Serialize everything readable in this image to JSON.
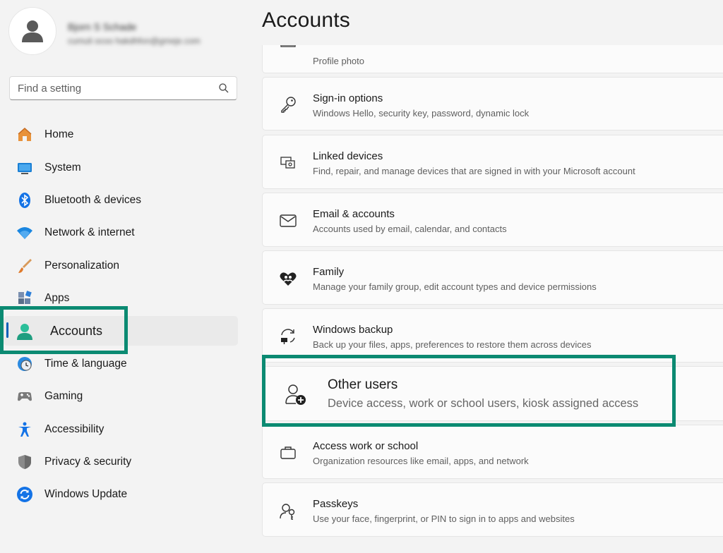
{
  "profile": {
    "name": "Bjorn S Schade",
    "email": "cumuli ocoo hakdhfon@gmeje.com"
  },
  "search": {
    "placeholder": "Find a setting"
  },
  "nav": {
    "items": [
      {
        "label": "Home",
        "icon": "home-icon"
      },
      {
        "label": "System",
        "icon": "system-icon"
      },
      {
        "label": "Bluetooth & devices",
        "icon": "bluetooth-icon"
      },
      {
        "label": "Network & internet",
        "icon": "wifi-icon"
      },
      {
        "label": "Personalization",
        "icon": "brush-icon"
      },
      {
        "label": "Apps",
        "icon": "apps-icon"
      },
      {
        "label": "Accounts",
        "icon": "account-icon"
      },
      {
        "label": "Time & language",
        "icon": "clock-globe-icon"
      },
      {
        "label": "Gaming",
        "icon": "gamepad-icon"
      },
      {
        "label": "Accessibility",
        "icon": "accessibility-icon"
      },
      {
        "label": "Privacy & security",
        "icon": "shield-icon"
      },
      {
        "label": "Windows Update",
        "icon": "update-icon"
      }
    ]
  },
  "main": {
    "title": "Accounts",
    "cards": [
      {
        "title": "",
        "subtitle": "Profile photo",
        "icon": "profile-photo-icon"
      },
      {
        "title": "Sign-in options",
        "subtitle": "Windows Hello, security key, password, dynamic lock",
        "icon": "key-icon"
      },
      {
        "title": "Linked devices",
        "subtitle": "Find, repair, and manage devices that are signed in with your Microsoft account",
        "icon": "linked-devices-icon"
      },
      {
        "title": "Email & accounts",
        "subtitle": "Accounts used by email, calendar, and contacts",
        "icon": "mail-icon"
      },
      {
        "title": "Family",
        "subtitle": "Manage your family group, edit account types and device permissions",
        "icon": "family-heart-icon"
      },
      {
        "title": "Windows backup",
        "subtitle": "Back up your files, apps, preferences to restore them across devices",
        "icon": "backup-icon"
      },
      {
        "title": "Other users",
        "subtitle": "Device access, work or school users, kiosk assigned access",
        "icon": "add-user-icon"
      },
      {
        "title": "Access work or school",
        "subtitle": "Organization resources like email, apps, and network",
        "icon": "briefcase-icon"
      },
      {
        "title": "Passkeys",
        "subtitle": "Use your face, fingerprint, or PIN to sign in to apps and websites",
        "icon": "passkey-icon"
      }
    ]
  },
  "colors": {
    "highlight": "#0b8a72",
    "accent": "#005fb8"
  }
}
